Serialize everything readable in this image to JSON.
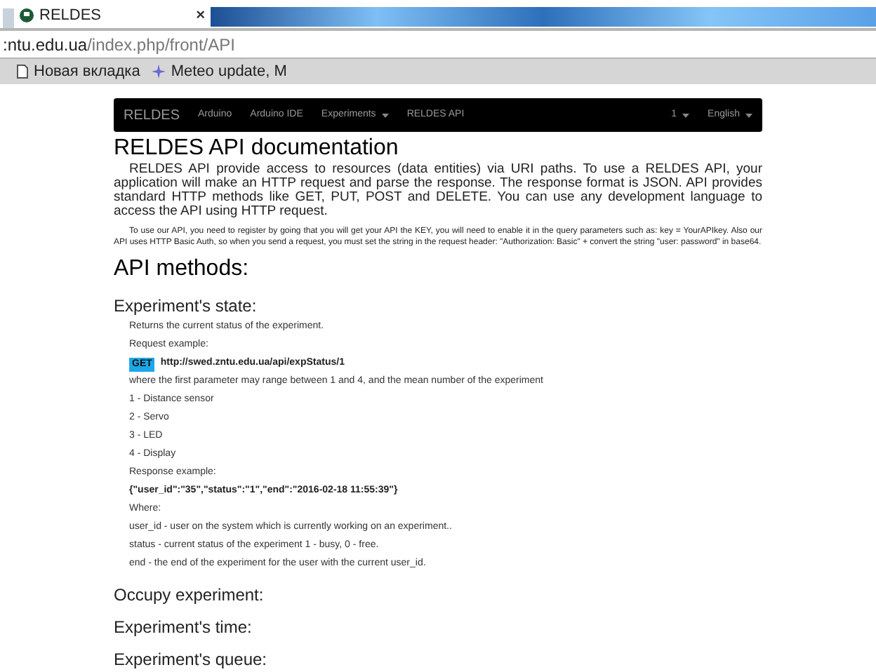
{
  "browser": {
    "tab_title": "RELDES",
    "tab_close": "×",
    "url_host": ":ntu.edu.ua",
    "url_path": "/index.php/front/API",
    "bookmarks": [
      {
        "kind": "page",
        "label": "Новая вкладка"
      },
      {
        "kind": "star",
        "label": "Meteo update, M"
      }
    ]
  },
  "navbar": {
    "brand": "RELDES",
    "items": [
      {
        "label": "Arduino",
        "caret": false
      },
      {
        "label": "Arduino IDE",
        "caret": false
      },
      {
        "label": "Experiments",
        "caret": true
      },
      {
        "label": "RELDES API",
        "caret": false
      }
    ],
    "right_items": [
      {
        "label": "1",
        "caret": true
      },
      {
        "label": "English",
        "caret": true
      }
    ]
  },
  "page": {
    "title": "RELDES API documentation",
    "intro": "RELDES API provide access to resources (data entities) via URI paths. To use a RELDES API, your application will make an HTTP request and parse the response. The response format is JSON. API provides standard HTTP methods like GET, PUT, POST and DELETE. You can use any development language to access the API using HTTP request.",
    "note": "To use our API, you need to register by going that you will get your API the KEY, you will need to enable it in the query parameters such as: key = YourAPIkey. Also our API uses HTTP Basic Auth, so when you send a request, you must set the string in the request header: \"Authorization: Basic\" + convert the string \"user: password\" in base64.",
    "methods_heading": "API methods:",
    "sections": [
      {
        "title": "Experiment's state:",
        "body": [
          {
            "kind": "text",
            "text": "Returns the current status of the experiment."
          },
          {
            "kind": "text",
            "text": "Request example:"
          },
          {
            "kind": "request",
            "method": "GET",
            "text": "http://swed.zntu.edu.ua/api/expStatus/1"
          },
          {
            "kind": "text",
            "text": "where the first parameter may range between 1 and 4, and the mean number of the experiment"
          },
          {
            "kind": "text",
            "text": "1 - Distance sensor"
          },
          {
            "kind": "text",
            "text": "2 - Servo"
          },
          {
            "kind": "text",
            "text": "3 - LED"
          },
          {
            "kind": "text",
            "text": "4 - Display"
          },
          {
            "kind": "text",
            "text": "Response example:"
          },
          {
            "kind": "code",
            "text": "{\"user_id\":\"35\",\"status\":\"1\",\"end\":\"2016-02-18 11:55:39\"}"
          },
          {
            "kind": "text",
            "text": "Where:"
          },
          {
            "kind": "text",
            "text": "user_id - user on the system which is currently working on an experiment.."
          },
          {
            "kind": "text",
            "text": "status - current status of the experiment 1 - busy, 0 - free."
          },
          {
            "kind": "text",
            "text": "end - the end of the experiment for the user with the current user_id."
          }
        ]
      },
      {
        "title": "Occupy experiment:"
      },
      {
        "title": "Experiment's time:"
      },
      {
        "title": "Experiment's queue:"
      }
    ]
  }
}
